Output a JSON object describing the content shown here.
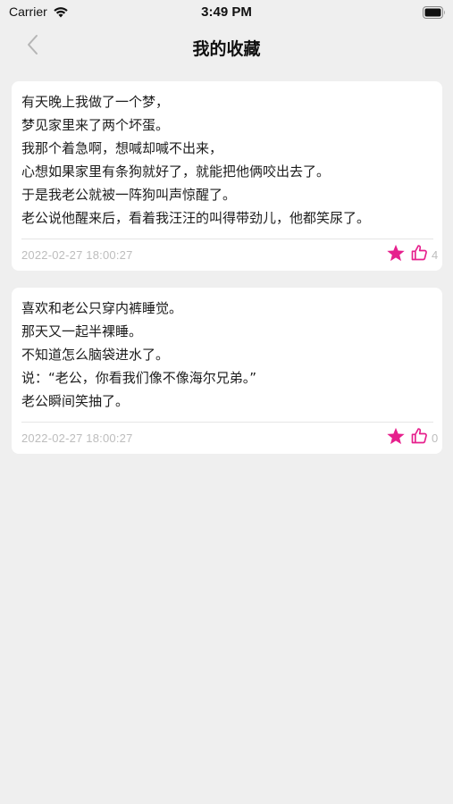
{
  "status_bar": {
    "carrier": "Carrier",
    "time": "3:49 PM"
  },
  "nav": {
    "title": "我的收藏"
  },
  "accent_color": "#e6208d",
  "favorites": [
    {
      "content": "有天晚上我做了一个梦，\n梦见家里来了两个坏蛋。\n我那个着急啊，想喊却喊不出来，\n心想如果家里有条狗就好了，就能把他俩咬出去了。\n于是我老公就被一阵狗叫声惊醒了。\n老公说他醒来后，看着我汪汪的叫得带劲儿，他都笑尿了。",
      "timestamp": "2022-02-27 18:00:27",
      "likes": "4"
    },
    {
      "content": "喜欢和老公只穿内裤睡觉。\n那天又一起半裸睡。\n不知道怎么脑袋进水了。\n说：“老公，你看我们像不像海尔兄弟。”\n老公瞬间笑抽了。",
      "timestamp": "2022-02-27 18:00:27",
      "likes": "0"
    }
  ]
}
